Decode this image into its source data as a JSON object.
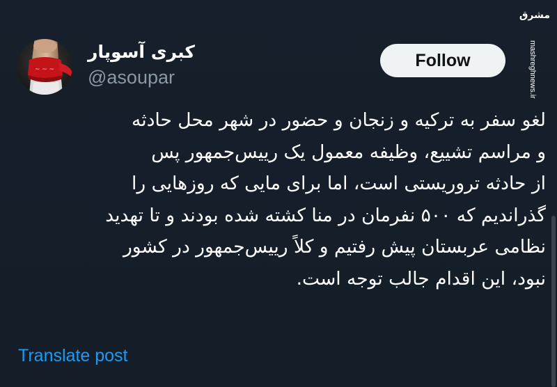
{
  "author": {
    "display_name": "کبری آسوپار",
    "handle": "@asoupar"
  },
  "follow_button": {
    "label": "Follow"
  },
  "tweet": {
    "lines": [
      "لغو سفر به ترکیه و زنجان و حضور در شهر محل حادثه",
      "و مراسم تشییع، وظیفه معمول یک رییس‌جمهور پس",
      "از حادثه تروریستی است، اما برای مایی که روزهایی را",
      "گذراندیم که ۵۰۰ نفرمان در منا کشته شده بودند و تا تهدید",
      "نظامی عربستان پیش رفتیم و کلاً رییس‌جمهور در کشور",
      "نبود، این اقدام جالب توجه است."
    ]
  },
  "translate": {
    "label": "Translate post"
  },
  "watermark": {
    "logo_text": "مشرق",
    "url": "mashreghnews.ir"
  },
  "colors": {
    "background": "#15202b",
    "text": "#ffffff",
    "secondary_text": "#8b98a5",
    "link": "#1d9bf0",
    "follow_bg": "#eff3f4",
    "follow_text": "#0f1419"
  }
}
